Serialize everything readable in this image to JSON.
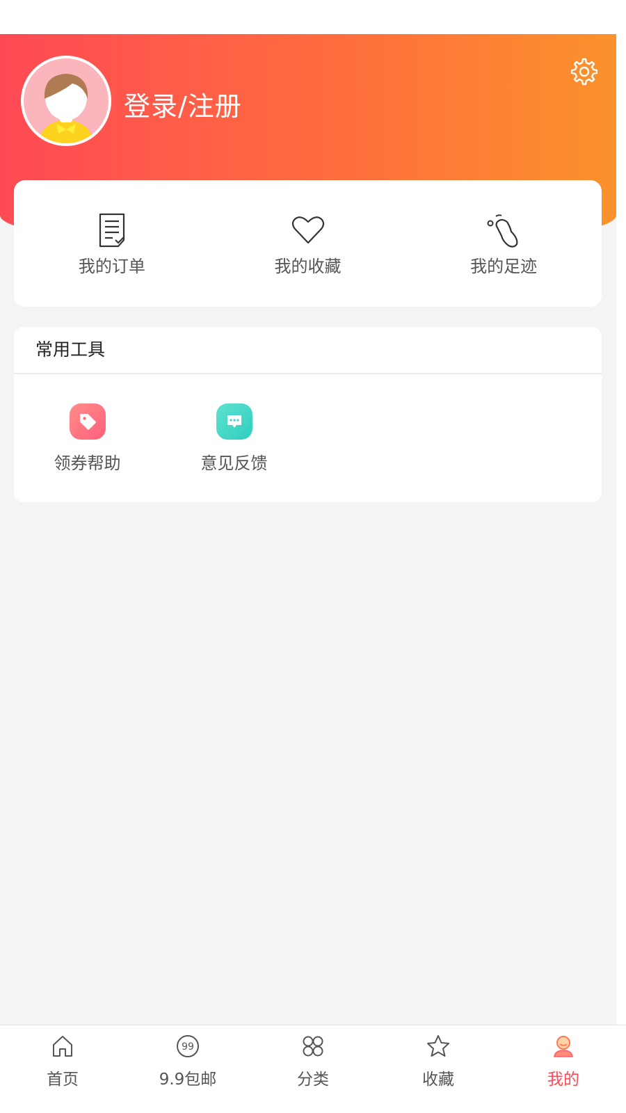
{
  "header": {
    "login_label": "登录/注册"
  },
  "quick_links": [
    {
      "label": "我的订单",
      "icon": "order-list-icon"
    },
    {
      "label": "我的收藏",
      "icon": "heart-icon"
    },
    {
      "label": "我的足迹",
      "icon": "footprint-icon"
    }
  ],
  "tools": {
    "title": "常用工具",
    "items": [
      {
        "label": "领券帮助",
        "icon": "coupon-tag-icon",
        "color": "#ff7a8a"
      },
      {
        "label": "意见反馈",
        "icon": "message-icon",
        "color": "#3fd8c6"
      }
    ]
  },
  "tab_bar": {
    "tabs": [
      {
        "label": "首页",
        "icon": "home-icon",
        "active": false
      },
      {
        "label": "9.9包邮",
        "icon": "nine-nine-icon",
        "active": false
      },
      {
        "label": "分类",
        "icon": "category-icon",
        "active": false
      },
      {
        "label": "收藏",
        "icon": "star-icon",
        "active": false
      },
      {
        "label": "我的",
        "icon": "profile-icon",
        "active": true
      }
    ]
  },
  "colors": {
    "gradient_start": "#ff4a55",
    "gradient_end": "#fb922c",
    "active_tab": "#ff4a55",
    "background": "#f4f4f4"
  }
}
